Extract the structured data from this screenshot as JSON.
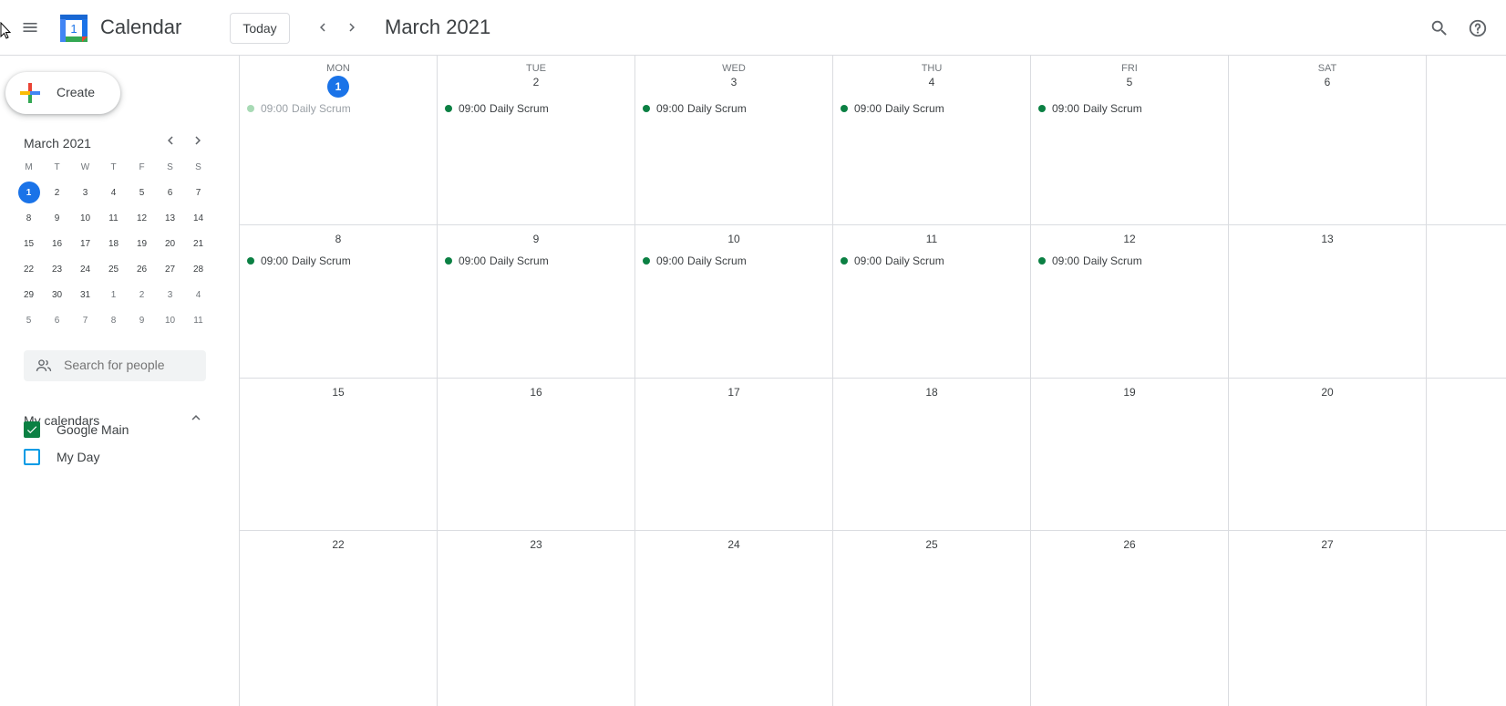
{
  "header": {
    "app_title": "Calendar",
    "logo_day": "1",
    "today_label": "Today",
    "month_title": "March 2021"
  },
  "sidebar": {
    "create_label": "Create",
    "mini_calendar": {
      "title": "March 2021",
      "weekday_headers": [
        "M",
        "T",
        "W",
        "T",
        "F",
        "S",
        "S"
      ],
      "weeks": [
        [
          "1",
          "2",
          "3",
          "4",
          "5",
          "6",
          "7"
        ],
        [
          "8",
          "9",
          "10",
          "11",
          "12",
          "13",
          "14"
        ],
        [
          "15",
          "16",
          "17",
          "18",
          "19",
          "20",
          "21"
        ],
        [
          "22",
          "23",
          "24",
          "25",
          "26",
          "27",
          "28"
        ],
        [
          "29",
          "30",
          "31",
          "1",
          "2",
          "3",
          "4"
        ],
        [
          "5",
          "6",
          "7",
          "8",
          "9",
          "10",
          "11"
        ]
      ],
      "today": "1"
    },
    "people_search_placeholder": "Search for people",
    "my_calendars_label": "My calendars",
    "calendars": [
      {
        "label": "Google Main",
        "checked": true,
        "color": "#0b8043"
      },
      {
        "label": "My Day",
        "checked": false,
        "color": "#039be5"
      }
    ]
  },
  "grid": {
    "weekday_headers": [
      "MON",
      "TUE",
      "WED",
      "THU",
      "FRI",
      "SAT"
    ],
    "weeks": [
      {
        "days": [
          {
            "num": "1",
            "today": true,
            "events": [
              {
                "time": "09:00",
                "title": "Daily Scrum",
                "past": true
              }
            ]
          },
          {
            "num": "2",
            "events": [
              {
                "time": "09:00",
                "title": "Daily Scrum"
              }
            ]
          },
          {
            "num": "3",
            "events": [
              {
                "time": "09:00",
                "title": "Daily Scrum"
              }
            ]
          },
          {
            "num": "4",
            "events": [
              {
                "time": "09:00",
                "title": "Daily Scrum"
              }
            ]
          },
          {
            "num": "5",
            "events": [
              {
                "time": "09:00",
                "title": "Daily Scrum"
              }
            ]
          },
          {
            "num": "6",
            "events": []
          }
        ]
      },
      {
        "days": [
          {
            "num": "8",
            "events": [
              {
                "time": "09:00",
                "title": "Daily Scrum"
              }
            ]
          },
          {
            "num": "9",
            "events": [
              {
                "time": "09:00",
                "title": "Daily Scrum"
              }
            ]
          },
          {
            "num": "10",
            "events": [
              {
                "time": "09:00",
                "title": "Daily Scrum"
              }
            ]
          },
          {
            "num": "11",
            "events": [
              {
                "time": "09:00",
                "title": "Daily Scrum"
              }
            ]
          },
          {
            "num": "12",
            "events": [
              {
                "time": "09:00",
                "title": "Daily Scrum"
              }
            ]
          },
          {
            "num": "13",
            "events": []
          }
        ]
      },
      {
        "days": [
          {
            "num": "15",
            "events": []
          },
          {
            "num": "16",
            "events": []
          },
          {
            "num": "17",
            "events": []
          },
          {
            "num": "18",
            "events": []
          },
          {
            "num": "19",
            "events": []
          },
          {
            "num": "20",
            "events": []
          }
        ]
      },
      {
        "days": [
          {
            "num": "22",
            "events": []
          },
          {
            "num": "23",
            "events": []
          },
          {
            "num": "24",
            "events": []
          },
          {
            "num": "25",
            "events": []
          },
          {
            "num": "26",
            "events": []
          },
          {
            "num": "27",
            "events": []
          }
        ]
      }
    ]
  },
  "colors": {
    "accent": "#1a73e8",
    "event": "#0b8043",
    "border": "#dadce0"
  }
}
